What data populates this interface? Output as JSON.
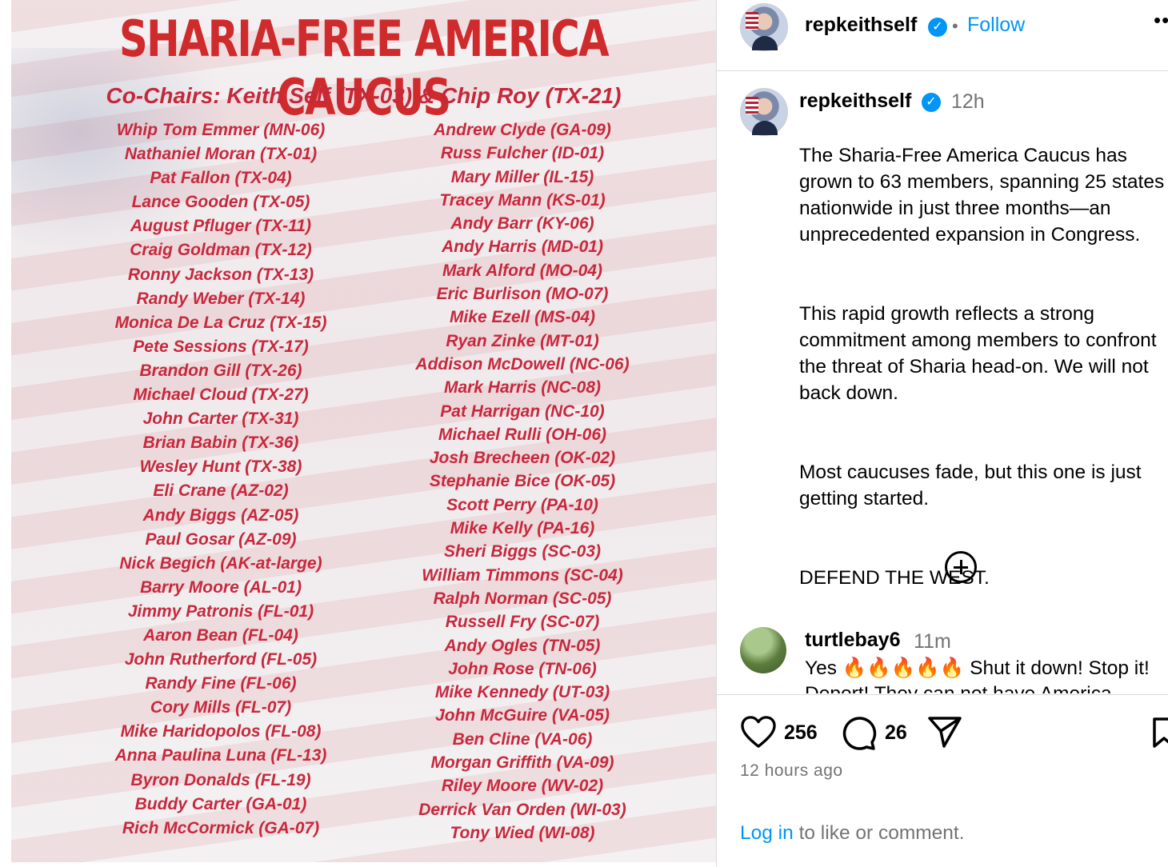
{
  "image": {
    "title": "SHARIA-FREE AMERICA CAUCUS",
    "cochairs": "Co-Chairs: Keith Self (TX-03) & Chip Roy (TX-21)",
    "members_left": [
      "Whip Tom Emmer (MN-06)",
      "Nathaniel Moran (TX-01)",
      "Pat Fallon (TX-04)",
      "Lance Gooden (TX-05)",
      "August Pfluger (TX-11)",
      "Craig Goldman (TX-12)",
      "Ronny Jackson (TX-13)",
      "Randy Weber (TX-14)",
      "Monica De La Cruz (TX-15)",
      "Pete Sessions (TX-17)",
      "Brandon Gill (TX-26)",
      "Michael Cloud (TX-27)",
      "John Carter (TX-31)",
      "Brian Babin (TX-36)",
      "Wesley Hunt (TX-38)",
      "Eli Crane (AZ-02)",
      "Andy Biggs (AZ-05)",
      "Paul Gosar (AZ-09)",
      "Nick Begich (AK-at-large)",
      "Barry Moore (AL-01)",
      "Jimmy Patronis (FL-01)",
      "Aaron Bean (FL-04)",
      "John Rutherford (FL-05)",
      "Randy Fine (FL-06)",
      "Cory Mills (FL-07)",
      "Mike Haridopolos (FL-08)",
      "Anna Paulina Luna (FL-13)",
      "Byron Donalds (FL-19)",
      "Buddy Carter (GA-01)",
      "Rich McCormick (GA-07)"
    ],
    "members_right": [
      "Andrew Clyde (GA-09)",
      "Russ Fulcher (ID-01)",
      "Mary Miller (IL-15)",
      "Tracey Mann (KS-01)",
      "Andy Barr (KY-06)",
      "Andy Harris (MD-01)",
      "Mark Alford (MO-04)",
      "Eric Burlison (MO-07)",
      "Mike Ezell (MS-04)",
      "Ryan Zinke (MT-01)",
      "Addison McDowell (NC-06)",
      "Mark Harris (NC-08)",
      "Pat Harrigan (NC-10)",
      "Michael Rulli (OH-06)",
      "Josh Brecheen (OK-02)",
      "Stephanie Bice (OK-05)",
      "Scott Perry (PA-10)",
      "Mike Kelly (PA-16)",
      "Sheri Biggs (SC-03)",
      "William Timmons (SC-04)",
      "Ralph Norman (SC-05)",
      "Russell Fry (SC-07)",
      "Andy Ogles (TN-05)",
      "John Rose (TN-06)",
      "Mike Kennedy (UT-03)",
      "John McGuire (VA-05)",
      "Ben Cline (VA-06)",
      "Morgan Griffith (VA-09)",
      "Riley Moore (WV-02)",
      "Derrick Van Orden (WI-03)",
      "Tony Wied (WI-08)"
    ],
    "title_color": "#cf2a2c",
    "text_color": "#c8283c"
  },
  "header": {
    "username": "repkeithself",
    "separator": "•",
    "follow_label": "Follow",
    "more_label": "••"
  },
  "caption": {
    "username": "repkeithself",
    "time": "12h",
    "paragraphs": [
      "The Sharia-Free America Caucus has grown to 63 members, spanning 25 states nationwide in just three months—an unprecedented expansion in Congress.",
      "This rapid growth reflects a strong commitment among members to confront the threat of Sharia head-on. We will not back down.",
      "Most caucuses fade, but this one is just getting started.",
      "DEFEND THE WEST."
    ]
  },
  "comment": {
    "username": "turtlebay6",
    "time": "11m",
    "text": "Yes 🔥🔥🔥🔥🔥 Shut it down! Stop it! Deport! They can not have America"
  },
  "actions": {
    "like_count": "256",
    "comment_count": "26",
    "post_time": "12 hours ago",
    "login_link": "Log in",
    "login_suffix": " to like or comment."
  },
  "colors": {
    "link_blue": "#0095f6",
    "muted_gray": "#737373",
    "divider": "#dbdbdb"
  }
}
